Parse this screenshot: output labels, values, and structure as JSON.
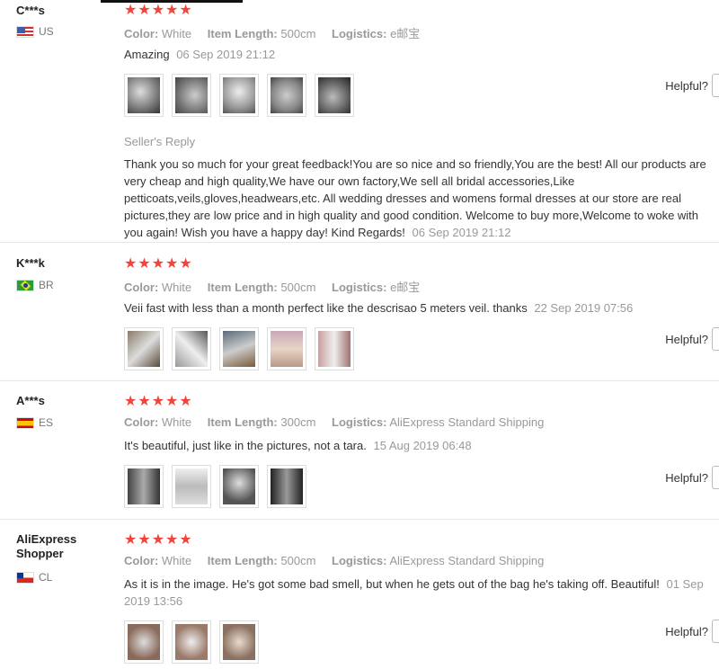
{
  "labels": {
    "color": "Color:",
    "length": "Item Length:",
    "logistics": "Logistics:",
    "helpful": "Helpful?",
    "seller_reply": "Seller's Reply"
  },
  "reviews": [
    {
      "user": "C***s",
      "country": "US",
      "stars": "★★★★★",
      "color": "White",
      "length": "500cm",
      "logistics": "e邮宝",
      "text": "Amazing",
      "date": "06 Sep 2019 21:12",
      "reply": "Thank you so much for your great feedback!You are so nice and so friendly,You are the best! All our products are very cheap and high quality,We have our own factory,We sell all bridal accessories,Like petticoats,veils,gloves,headwears,etc. All wedding dresses and womens formal dresses at our store are real pictures,they are low price and in high quality and good condition. Welcome to buy more,Welcome to woke with you again! Wish you have a happy day! Kind Regards!",
      "reply_date": "06 Sep 2019 21:12"
    },
    {
      "user": "K***k",
      "country": "BR",
      "stars": "★★★★★",
      "color": "White",
      "length": "500cm",
      "logistics": "e邮宝",
      "text": "Veii fast with less than a month perfect like the descrisao 5 meters veil. thanks",
      "date": "22 Sep 2019 07:56"
    },
    {
      "user": "A***s",
      "country": "ES",
      "stars": "★★★★★",
      "color": "White",
      "length": "300cm",
      "logistics": "AliExpress Standard Shipping",
      "text": "It's beautiful, just like in the pictures, not a tara.",
      "date": "15 Aug 2019 06:48"
    },
    {
      "user": "AliExpress Shopper",
      "country": "CL",
      "stars": "★★★★★",
      "color": "White",
      "length": "500cm",
      "logistics": "AliExpress Standard Shipping",
      "text": "As it is in the image. He's got some bad smell, but when he gets out of the bag he's taking off. Beautiful!",
      "date": "01 Sep 2019 13:56"
    }
  ],
  "colors": {
    "star": "#f1443b",
    "muted": "#999999"
  }
}
